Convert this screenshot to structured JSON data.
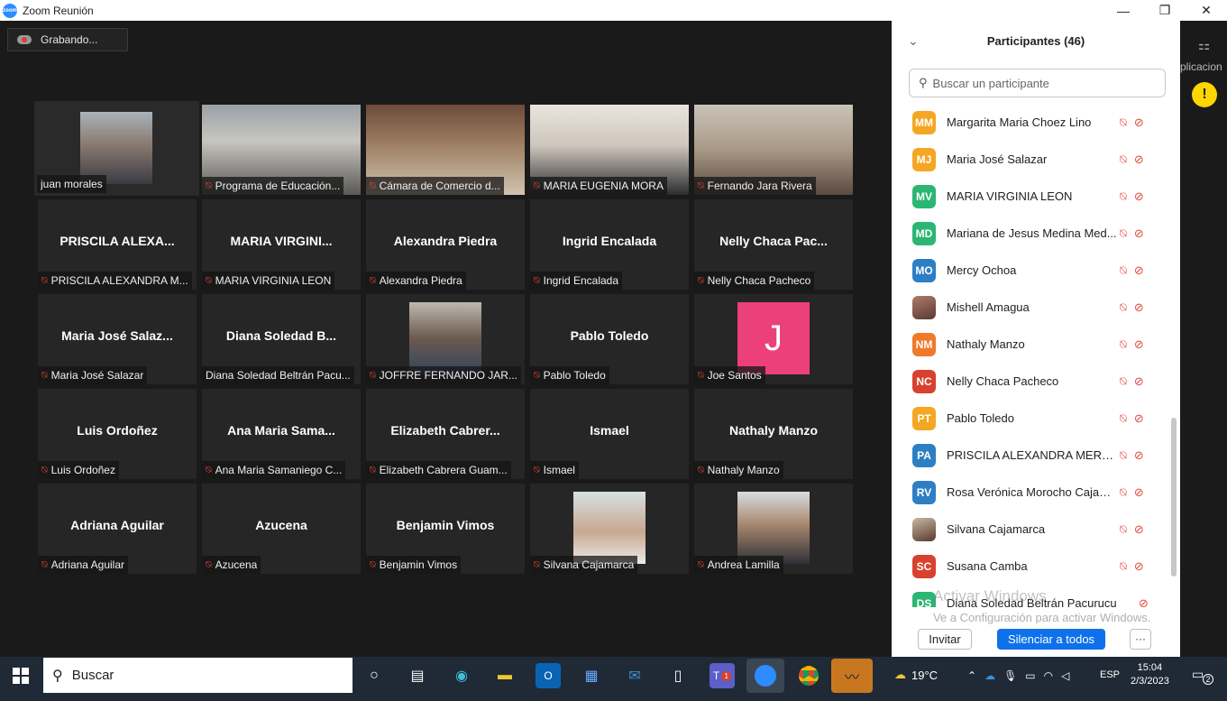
{
  "window": {
    "title": "Zoom Reunión",
    "minimize_glyph": "—",
    "maximize_glyph": "❐",
    "close_glyph": "✕"
  },
  "recording": {
    "label": "Grabando..."
  },
  "tiles": [
    {
      "big": "",
      "label": "juan morales",
      "muted": false,
      "video": "juan"
    },
    {
      "big": "",
      "label": "Programa de Educación...",
      "muted": true,
      "video": "programa"
    },
    {
      "big": "",
      "label": "Cámara de Comercio d...",
      "muted": true,
      "video": "camara"
    },
    {
      "big": "",
      "label": "MARIA EUGENIA MORA",
      "muted": true,
      "video": "maria"
    },
    {
      "big": "",
      "label": "Fernando Jara Rivera",
      "muted": true,
      "video": "fernando"
    },
    {
      "big": "PRISCILA ALEXA...",
      "label": "PRISCILA ALEXANDRA M...",
      "muted": true
    },
    {
      "big": "MARIA VIRGINI...",
      "label": "MARIA VIRGINIA LEON",
      "muted": true
    },
    {
      "big": "Alexandra Piedra",
      "label": "Alexandra Piedra",
      "muted": true
    },
    {
      "big": "Ingrid Encalada",
      "label": "Ingrid Encalada",
      "muted": true
    },
    {
      "big": "Nelly Chaca Pac...",
      "label": "Nelly Chaca Pacheco",
      "muted": true
    },
    {
      "big": "Maria José Salaz...",
      "label": "Maria José Salazar",
      "muted": true
    },
    {
      "big": "Diana Soledad B...",
      "label": "Diana Soledad Beltrán Pacu...",
      "muted": false
    },
    {
      "big": "",
      "label": "JOFFRE FERNANDO JAR...",
      "muted": true,
      "video": "joffre"
    },
    {
      "big": "Pablo Toledo",
      "label": "Pablo Toledo",
      "muted": true
    },
    {
      "big": "",
      "label": "Joe Santos",
      "muted": true,
      "avatar_letter": "J"
    },
    {
      "big": "Luis Ordoñez",
      "label": "Luis Ordoñez",
      "muted": true
    },
    {
      "big": "Ana Maria Sama...",
      "label": "Ana Maria Samaniego C...",
      "muted": true
    },
    {
      "big": "Elizabeth Cabrer...",
      "label": "Elizabeth Cabrera Guam...",
      "muted": true
    },
    {
      "big": "Ismael",
      "label": "Ismael",
      "muted": true
    },
    {
      "big": "Nathaly Manzo",
      "label": "Nathaly Manzo",
      "muted": true
    },
    {
      "big": "Adriana Aguilar",
      "label": "Adriana Aguilar",
      "muted": true
    },
    {
      "big": "Azucena",
      "label": "Azucena",
      "muted": true
    },
    {
      "big": "Benjamin Vimos",
      "label": "Benjamin Vimos",
      "muted": true
    },
    {
      "big": "",
      "label": "Silvana Cajamarca",
      "muted": true,
      "video": "silvana"
    },
    {
      "big": "",
      "label": "Andrea Lamilla",
      "muted": true,
      "video": "andrea"
    }
  ],
  "panel": {
    "title": "Participantes (46)",
    "search_placeholder": "Buscar un participante",
    "participants": [
      {
        "initials": "MM",
        "color": "#f5a623",
        "name": "Margarita Maria Choez Lino"
      },
      {
        "initials": "MJ",
        "color": "#f5a623",
        "name": "Maria José Salazar"
      },
      {
        "initials": "MV",
        "color": "#2bb673",
        "name": "MARIA VIRGINIA LEON"
      },
      {
        "initials": "MD",
        "color": "#2bb673",
        "name": "Mariana de Jesus Medina Med..."
      },
      {
        "initials": "MO",
        "color": "#2d7fc4",
        "name": "Mercy Ochoa"
      },
      {
        "initials": "",
        "color": "#b07a6a",
        "name": "Mishell Amagua",
        "photo": true
      },
      {
        "initials": "NM",
        "color": "#f07a2a",
        "name": "Nathaly Manzo"
      },
      {
        "initials": "NC",
        "color": "#d9412f",
        "name": "Nelly Chaca Pacheco"
      },
      {
        "initials": "PT",
        "color": "#f5a623",
        "name": "Pablo Toledo"
      },
      {
        "initials": "PA",
        "color": "#2d7fc4",
        "name": "PRISCILA ALEXANDRA MERCHA..."
      },
      {
        "initials": "RV",
        "color": "#2d7fc4",
        "name": "Rosa Verónica Morocho Cajam..."
      },
      {
        "initials": "",
        "color": "#c9b8a0",
        "name": "Silvana Cajamarca",
        "photo": true
      },
      {
        "initials": "SC",
        "color": "#d9412f",
        "name": "Susana Camba"
      },
      {
        "initials": "DS",
        "color": "#2bb673",
        "name": "Diana Soledad Beltrán Pacurucu"
      }
    ],
    "watermark_title": "Activar Windows",
    "watermark_sub": "Ve a Configuración para activar Windows.",
    "invite_label": "Invitar",
    "mute_all_label": "Silenciar a todos",
    "more_label": "···"
  },
  "rail": {
    "label": "plicacion",
    "warning": "!"
  },
  "taskbar": {
    "search_placeholder": "Buscar",
    "weather": "19°C",
    "lang": "ESP",
    "time": "15:04",
    "date": "2/3/2023",
    "notifications": "2",
    "teams_badge": "1"
  }
}
